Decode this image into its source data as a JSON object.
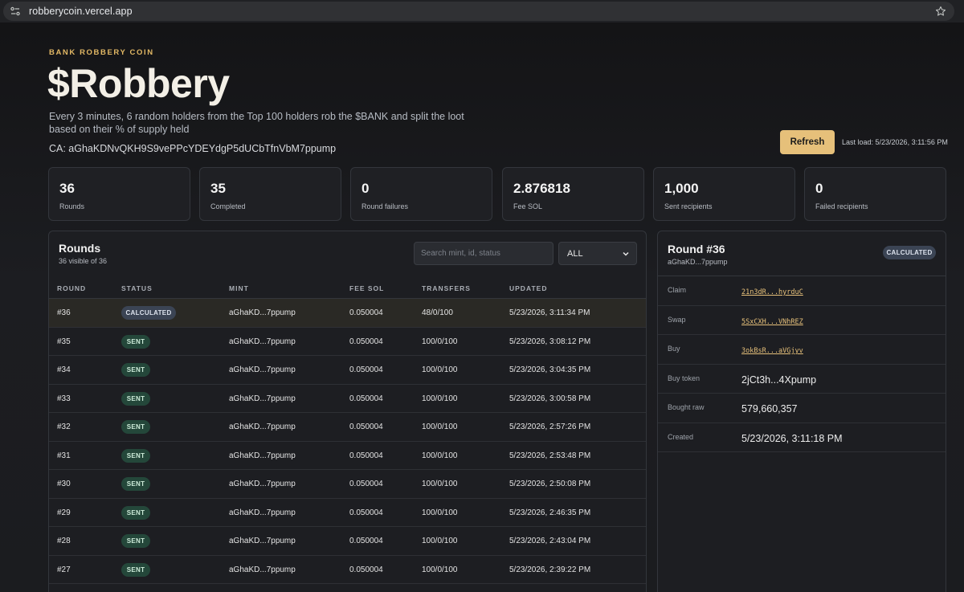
{
  "browser": {
    "url": "robberycoin.vercel.app"
  },
  "hero": {
    "eyebrow": "BANK ROBBERY COIN",
    "title": "$Robbery",
    "description": "Every 3 minutes, 6 random holders from the Top 100 holders rob the $BANK and split the loot based on their % of supply held",
    "ca": "CA: aGhaKDNvQKH9S9vePPcYDEYdgP5dUCbTfnVbM7ppump"
  },
  "toolbar": {
    "refresh_label": "Refresh",
    "last_load": "Last load: 5/23/2026, 3:11:56 PM"
  },
  "stats": [
    {
      "value": "36",
      "label": "Rounds"
    },
    {
      "value": "35",
      "label": "Completed"
    },
    {
      "value": "0",
      "label": "Round failures"
    },
    {
      "value": "2.876818",
      "label": "Fee SOL"
    },
    {
      "value": "1,000",
      "label": "Sent recipients"
    },
    {
      "value": "0",
      "label": "Failed recipients"
    }
  ],
  "rounds": {
    "title": "Rounds",
    "subtitle": "36 visible of 36",
    "search_placeholder": "Search mint, id, status",
    "filter_value": "ALL",
    "columns": [
      "ROUND",
      "STATUS",
      "MINT",
      "FEE SOL",
      "TRANSFERS",
      "UPDATED"
    ],
    "rows": [
      {
        "round": "#36",
        "status": "CALCULATED",
        "mint": "aGhaKD...7ppump",
        "fee": "0.050004",
        "transfers": "48/0/100",
        "updated": "5/23/2026, 3:11:34 PM"
      },
      {
        "round": "#35",
        "status": "SENT",
        "mint": "aGhaKD...7ppump",
        "fee": "0.050004",
        "transfers": "100/0/100",
        "updated": "5/23/2026, 3:08:12 PM"
      },
      {
        "round": "#34",
        "status": "SENT",
        "mint": "aGhaKD...7ppump",
        "fee": "0.050004",
        "transfers": "100/0/100",
        "updated": "5/23/2026, 3:04:35 PM"
      },
      {
        "round": "#33",
        "status": "SENT",
        "mint": "aGhaKD...7ppump",
        "fee": "0.050004",
        "transfers": "100/0/100",
        "updated": "5/23/2026, 3:00:58 PM"
      },
      {
        "round": "#32",
        "status": "SENT",
        "mint": "aGhaKD...7ppump",
        "fee": "0.050004",
        "transfers": "100/0/100",
        "updated": "5/23/2026, 2:57:26 PM"
      },
      {
        "round": "#31",
        "status": "SENT",
        "mint": "aGhaKD...7ppump",
        "fee": "0.050004",
        "transfers": "100/0/100",
        "updated": "5/23/2026, 2:53:48 PM"
      },
      {
        "round": "#30",
        "status": "SENT",
        "mint": "aGhaKD...7ppump",
        "fee": "0.050004",
        "transfers": "100/0/100",
        "updated": "5/23/2026, 2:50:08 PM"
      },
      {
        "round": "#29",
        "status": "SENT",
        "mint": "aGhaKD...7ppump",
        "fee": "0.050004",
        "transfers": "100/0/100",
        "updated": "5/23/2026, 2:46:35 PM"
      },
      {
        "round": "#28",
        "status": "SENT",
        "mint": "aGhaKD...7ppump",
        "fee": "0.050004",
        "transfers": "100/0/100",
        "updated": "5/23/2026, 2:43:04 PM"
      },
      {
        "round": "#27",
        "status": "SENT",
        "mint": "aGhaKD...7ppump",
        "fee": "0.050004",
        "transfers": "100/0/100",
        "updated": "5/23/2026, 2:39:22 PM"
      }
    ]
  },
  "detail": {
    "title": "Round #36",
    "subtitle": "aGhaKD...7ppump",
    "badge": "CALCULATED",
    "rows": [
      {
        "label": "Claim",
        "value": "21n3dR...hyrduC",
        "kind": "link"
      },
      {
        "label": "Swap",
        "value": "5SxCXH...VNhREZ",
        "kind": "link"
      },
      {
        "label": "Buy",
        "value": "3okBsR...aVGjyv",
        "kind": "link"
      },
      {
        "label": "Buy token",
        "value": "2jCt3h...4Xpump",
        "kind": "text"
      },
      {
        "label": "Bought raw",
        "value": "579,660,357",
        "kind": "text"
      },
      {
        "label": "Created",
        "value": "5/23/2026, 3:11:18 PM",
        "kind": "text"
      }
    ]
  },
  "colors": {
    "accent": "#e6c07a",
    "eyebrow": "#e2b865",
    "calc_badge": "#3b4454",
    "sent_badge": "#24473a"
  }
}
